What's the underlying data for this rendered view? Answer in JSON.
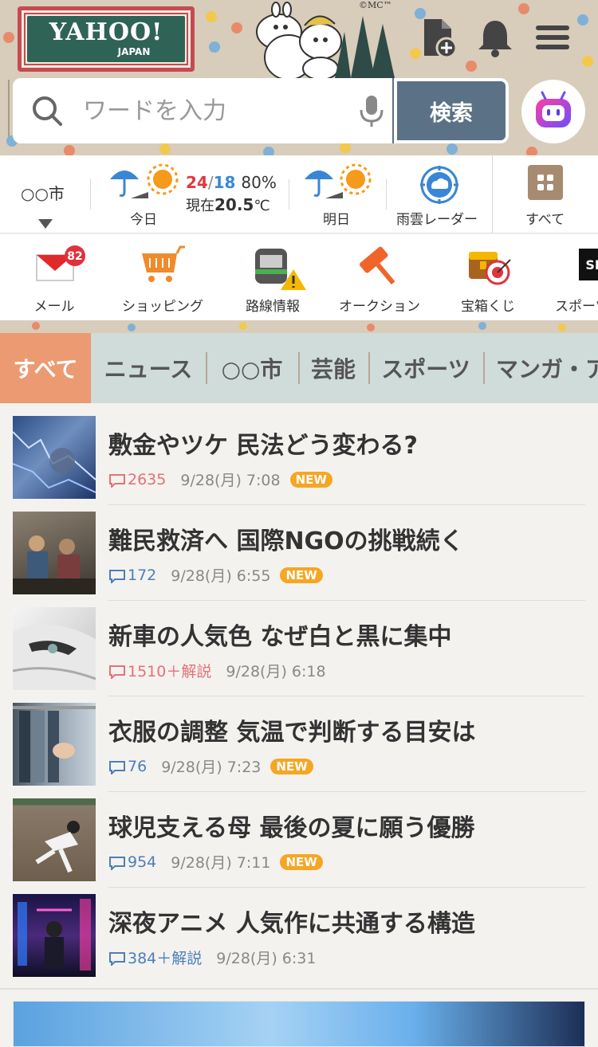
{
  "header": {
    "logo_main": "YAHOO!",
    "logo_sub": "JAPAN",
    "copyright": "©MC™",
    "search": {
      "placeholder": "ワードを入力",
      "button_label": "検索"
    }
  },
  "weather": {
    "city": "○○市",
    "today_label": "今日",
    "high": "24",
    "low": "18",
    "rain": "80%",
    "now_prefix": "現在",
    "now_temp": "20.5",
    "now_unit": "℃",
    "tomorrow_label": "明日",
    "radar_label": "雨雲レーダー",
    "all_label": "すべて"
  },
  "services": [
    {
      "label": "メール",
      "badge": "82"
    },
    {
      "label": "ショッピング"
    },
    {
      "label": "路線情報"
    },
    {
      "label": "オークション"
    },
    {
      "label": "宝箱くじ"
    },
    {
      "label": "スポーツ",
      "icon_text": "SP"
    }
  ],
  "tabs": [
    "すべて",
    "ニュース",
    "○○市",
    "芸能",
    "スポーツ",
    "マンガ・ア"
  ],
  "news": [
    {
      "title": "敷金やツケ 民法どう変わる?",
      "comments": "2635",
      "date": "9/28(月) 7:08",
      "new": "NEW",
      "hot": true
    },
    {
      "title": "難民救済へ 国際NGOの挑戦続く",
      "comments": "172",
      "date": "9/28(月) 6:55",
      "new": "NEW",
      "hot": false
    },
    {
      "title": "新車の人気色 なぜ白と黒に集中",
      "comments": "1510＋解説",
      "date": "9/28(月) 6:18",
      "hot": true
    },
    {
      "title": "衣服の調整 気温で判断する目安は",
      "comments": "76",
      "date": "9/28(月) 7:23",
      "new": "NEW",
      "hot": false
    },
    {
      "title": "球児支える母 最後の夏に願う優勝",
      "comments": "954",
      "date": "9/28(月) 7:11",
      "new": "NEW",
      "hot": false
    },
    {
      "title": "深夜アニメ 人気作に共通する構造",
      "comments": "384＋解説",
      "date": "9/28(月) 6:31",
      "hot": false
    }
  ],
  "colors": {
    "header_bg": "#d8ccbb",
    "search_button": "#5a7186",
    "tab_active": "#eb9a72",
    "tab_bg": "#cfdcd9",
    "hot_count": "#e4707a",
    "normal_count": "#4a7fb8",
    "new_badge": "#f5a623"
  },
  "icons": [
    "file-plus-icon",
    "bell-icon",
    "menu-icon",
    "search-icon",
    "mic-icon",
    "assistant-icon",
    "umbrella-sun-icon",
    "radar-icon",
    "grid-icon",
    "mail-icon",
    "cart-icon",
    "train-icon",
    "gavel-icon",
    "treasure-icon",
    "comment-icon"
  ]
}
